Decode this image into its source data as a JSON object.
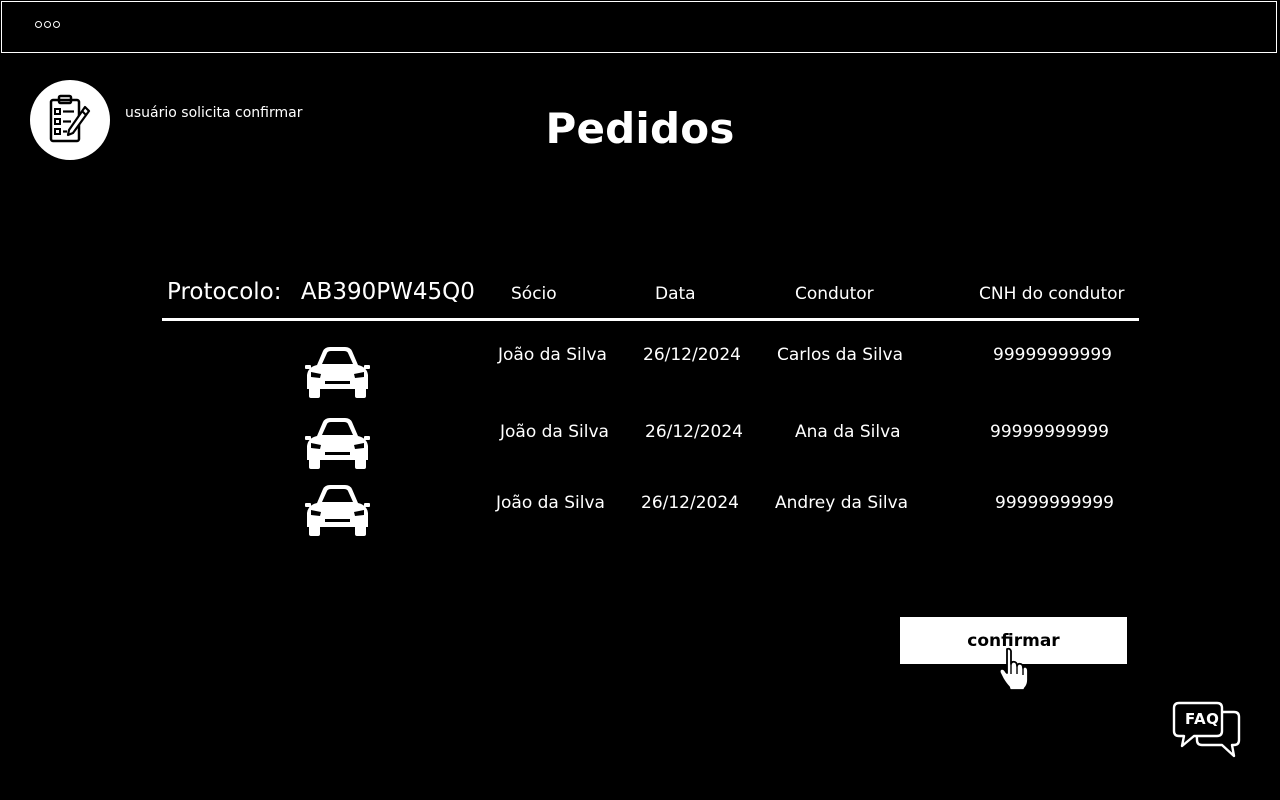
{
  "window": {
    "dots": [
      "o",
      "o",
      "o"
    ]
  },
  "badge": {
    "icon": "clipboard-checklist-icon",
    "caption": "usuário solicita confirmar"
  },
  "page": {
    "title": "Pedidos"
  },
  "table": {
    "protocol_label": "Protocolo:",
    "protocol_value": "AB390PW45Q0",
    "columns": [
      "Sócio",
      "Data",
      "Condutor",
      "CNH do condutor"
    ],
    "rows": [
      {
        "icon": "car-icon",
        "socio": "João da Silva",
        "data": "26/12/2024",
        "condutor": "Carlos da Silva",
        "cnh": "99999999999"
      },
      {
        "icon": "car-icon",
        "socio": "João da Silva",
        "data": "26/12/2024",
        "condutor": "Ana da Silva",
        "cnh": "99999999999"
      },
      {
        "icon": "car-icon",
        "socio": "João da Silva",
        "data": "26/12/2024",
        "condutor": "Andrey da Silva",
        "cnh": "99999999999"
      }
    ]
  },
  "actions": {
    "confirm_label": "confirmar",
    "cursor_icon": "hand-pointer-icon"
  },
  "faq": {
    "label": "FAQ",
    "icon": "chat-bubbles-icon"
  },
  "colors": {
    "background": "#000000",
    "foreground": "#ffffff"
  }
}
